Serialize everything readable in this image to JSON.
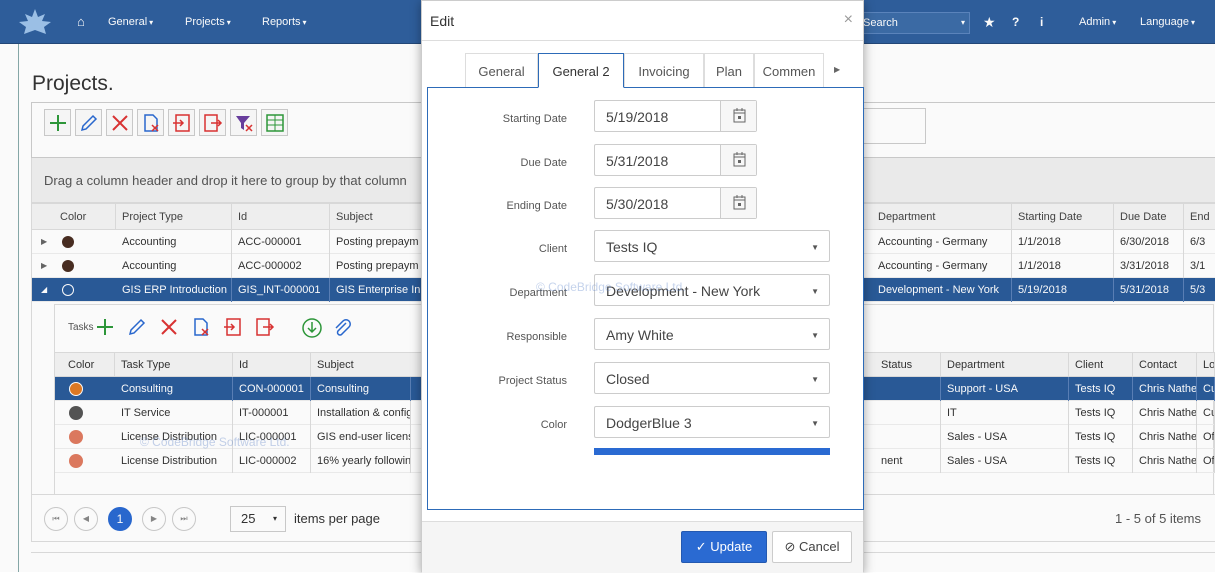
{
  "topbar": {
    "nav": [
      {
        "label": "General"
      },
      {
        "label": "Projects"
      },
      {
        "label": "Reports"
      }
    ],
    "search_placeholder": "Search",
    "right_menu": [
      {
        "label": "Admin"
      },
      {
        "label": "Language"
      }
    ],
    "color": "#2f5f9e"
  },
  "page": {
    "title": "Projects.",
    "group_hint": "Drag a column header and drop it here to group by that column"
  },
  "grid": {
    "columns": [
      "Color",
      "Project Type",
      "Id",
      "Subject",
      "Department",
      "Starting Date",
      "Due Date",
      "End"
    ],
    "rows": [
      {
        "color": "#4a2e22",
        "type": "Accounting",
        "id": "ACC-000001",
        "subject": "Posting prepaym",
        "department": "Accounting - Germany",
        "start": "1/1/2018",
        "due": "6/30/2018",
        "end": "6/3"
      },
      {
        "color": "#4a2e22",
        "type": "Accounting",
        "id": "ACC-000002",
        "subject": "Posting prepaym",
        "department": "Accounting - Germany",
        "start": "1/1/2018",
        "due": "3/31/2018",
        "end": "3/1"
      },
      {
        "color": "#ffffff",
        "type": "GIS ERP Introduction",
        "id": "GIS_INT-000001",
        "subject": "GIS Enterprise In",
        "department": "Development - New York",
        "start": "5/19/2018",
        "due": "5/31/2018",
        "end": "5/3"
      }
    ]
  },
  "subgrid": {
    "tasks_label": "Tasks",
    "columns": [
      "Color",
      "Task Type",
      "Id",
      "Subject",
      "Status",
      "Department",
      "Client",
      "Contact",
      "Lo"
    ],
    "rows": [
      {
        "color": "#e07b25",
        "type": "Consulting",
        "id": "CON-000001",
        "subject": "Consulting",
        "status": "",
        "department": "Support - USA",
        "client": "Tests IQ",
        "contact": "Chris Nathen",
        "lo": "Cu"
      },
      {
        "color": "#555555",
        "type": "IT Service",
        "id": "IT-000001",
        "subject": "Installation & configu",
        "status": "",
        "department": "IT",
        "client": "Tests IQ",
        "contact": "Chris Nathen",
        "lo": "Cu"
      },
      {
        "color": "#e07b60",
        "type": "License Distribution",
        "id": "LIC-000001",
        "subject": "GIS end-user license.",
        "status": "",
        "department": "Sales - USA",
        "client": "Tests IQ",
        "contact": "Chris Nathen",
        "lo": "Of"
      },
      {
        "color": "#e07b60",
        "type": "License Distribution",
        "id": "LIC-000002",
        "subject": "16% yearly following.",
        "status": "nent",
        "department": "Sales - USA",
        "client": "Tests IQ",
        "contact": "Chris Nathen",
        "lo": "Of"
      }
    ]
  },
  "pager": {
    "current_page": "1",
    "page_size": "25",
    "items_label": "items per page",
    "summary": "1 - 5 of 5 items"
  },
  "watermark": "© CodeBridge Software Ltd.",
  "dialog": {
    "title": "Edit",
    "tabs": [
      {
        "label": "General"
      },
      {
        "label": "General 2"
      },
      {
        "label": "Invoicing"
      },
      {
        "label": "Plan"
      },
      {
        "label": "Commen"
      }
    ],
    "fields": {
      "starting_date": {
        "label": "Starting Date",
        "value": "5/19/2018"
      },
      "due_date": {
        "label": "Due Date",
        "value": "5/31/2018"
      },
      "ending_date": {
        "label": "Ending Date",
        "value": "5/30/2018"
      },
      "client": {
        "label": "Client",
        "value": "Tests IQ"
      },
      "department": {
        "label": "Department",
        "value": "Development - New York"
      },
      "responsible": {
        "label": "Responsible",
        "value": "Amy White"
      },
      "project_status": {
        "label": "Project Status",
        "value": "Closed"
      },
      "color": {
        "label": "Color",
        "value": "DodgerBlue 3",
        "swatch": "#2a6ad2"
      }
    },
    "update_label": "Update",
    "cancel_label": "Cancel"
  }
}
